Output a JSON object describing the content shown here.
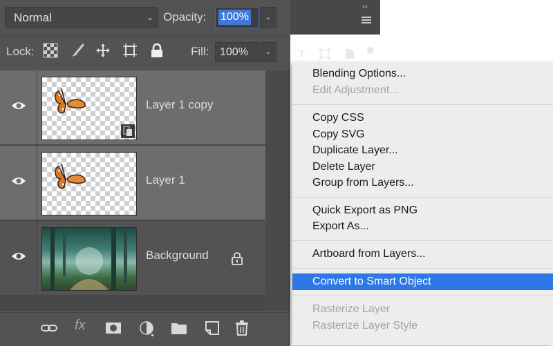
{
  "blend_mode": {
    "selected": "Normal"
  },
  "opacity": {
    "label": "Opacity:",
    "value": "100%"
  },
  "lock": {
    "label": "Lock:"
  },
  "fill": {
    "label": "Fill:",
    "value": "100%"
  },
  "layers": [
    {
      "name": "Layer 1 copy",
      "selected": true,
      "thumbnail": "butterfly-icon",
      "smart_object_badge": true
    },
    {
      "name": "Layer 1",
      "selected": true,
      "thumbnail": "butterfly-icon"
    },
    {
      "name": "Background",
      "selected": false,
      "thumbnail": "forest-image",
      "locked": true
    }
  ],
  "context_menu": {
    "groups": [
      [
        {
          "label": "Blending Options...",
          "enabled": true
        },
        {
          "label": "Edit Adjustment...",
          "enabled": false
        }
      ],
      [
        {
          "label": "Copy CSS",
          "enabled": true
        },
        {
          "label": "Copy SVG",
          "enabled": true
        },
        {
          "label": "Duplicate Layer...",
          "enabled": true
        },
        {
          "label": "Delete Layer",
          "enabled": true
        },
        {
          "label": "Group from Layers...",
          "enabled": true
        }
      ],
      [
        {
          "label": "Quick Export as PNG",
          "enabled": true
        },
        {
          "label": "Export As...",
          "enabled": true
        }
      ],
      [
        {
          "label": "Artboard from Layers...",
          "enabled": true
        }
      ],
      [
        {
          "label": "Convert to Smart Object",
          "enabled": true,
          "highlighted": true
        }
      ],
      [
        {
          "label": "Rasterize Layer",
          "enabled": false
        },
        {
          "label": "Rasterize Layer Style",
          "enabled": false
        }
      ]
    ]
  },
  "colors": {
    "panel": "#535353",
    "selection": "#6d6d6d",
    "menu_highlight": "#2e77e6",
    "accent": "#3f78d9"
  }
}
